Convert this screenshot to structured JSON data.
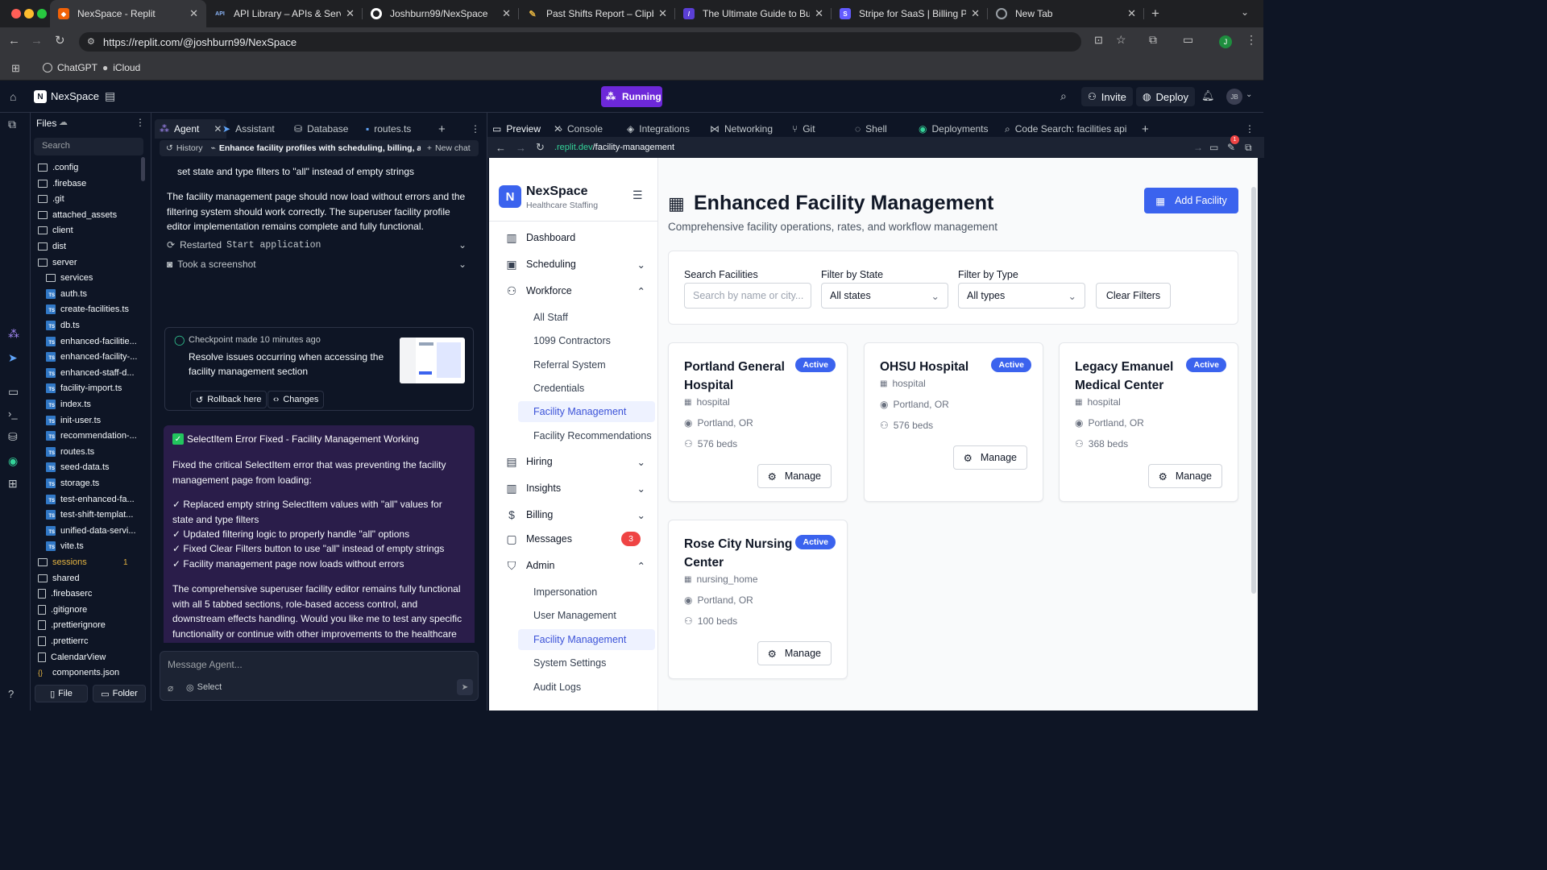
{
  "browser": {
    "tabs": [
      {
        "title": "NexSpace - Replit",
        "icon": "replit-icon",
        "color": "#f26207"
      },
      {
        "title": "API Library – APIs & Services",
        "icon": "api-icon",
        "color": "#4285f4"
      },
      {
        "title": "Joshburn99/NexSpace",
        "icon": "github-icon",
        "color": "#ffffff"
      },
      {
        "title": "Past Shifts Report – Clipboard",
        "icon": "clipboard-icon",
        "color": "#e3b341"
      },
      {
        "title": "The Ultimate Guide to Building",
        "icon": "guide-icon",
        "color": "#5b3fd6"
      },
      {
        "title": "Stripe for SaaS | Billing Platform",
        "icon": "stripe-icon",
        "color": "#635bff"
      },
      {
        "title": "New Tab",
        "icon": "chrome-icon",
        "color": "#9aa0a6"
      }
    ],
    "url": "https://replit.com/@joshburn99/NexSpace",
    "bookmarks": [
      "ChatGPT",
      "iCloud"
    ],
    "profile_initial": "J"
  },
  "replit": {
    "project": "NexSpace",
    "status": "Running",
    "invite": "Invite",
    "deploy": "Deploy",
    "avatar": "JB"
  },
  "files": {
    "title": "Files",
    "search_placeholder": "Search",
    "items": [
      {
        "name": ".config",
        "type": "folder",
        "depth": 0
      },
      {
        "name": ".firebase",
        "type": "folder",
        "depth": 0
      },
      {
        "name": ".git",
        "type": "folder",
        "depth": 0
      },
      {
        "name": "attached_assets",
        "type": "folder",
        "depth": 0
      },
      {
        "name": "client",
        "type": "folder",
        "depth": 0
      },
      {
        "name": "dist",
        "type": "folder",
        "depth": 0
      },
      {
        "name": "server",
        "type": "folder-open",
        "depth": 0
      },
      {
        "name": "services",
        "type": "folder",
        "depth": 1
      },
      {
        "name": "auth.ts",
        "type": "ts",
        "depth": 1
      },
      {
        "name": "create-facilities.ts",
        "type": "ts",
        "depth": 1
      },
      {
        "name": "db.ts",
        "type": "ts",
        "depth": 1
      },
      {
        "name": "enhanced-facilitie...",
        "type": "ts",
        "depth": 1
      },
      {
        "name": "enhanced-facility-...",
        "type": "ts",
        "depth": 1
      },
      {
        "name": "enhanced-staff-d...",
        "type": "ts",
        "depth": 1
      },
      {
        "name": "facility-import.ts",
        "type": "ts",
        "depth": 1
      },
      {
        "name": "index.ts",
        "type": "ts",
        "depth": 1
      },
      {
        "name": "init-user.ts",
        "type": "ts",
        "depth": 1
      },
      {
        "name": "recommendation-...",
        "type": "ts",
        "depth": 1
      },
      {
        "name": "routes.ts",
        "type": "ts",
        "depth": 1
      },
      {
        "name": "seed-data.ts",
        "type": "ts",
        "depth": 1
      },
      {
        "name": "storage.ts",
        "type": "ts",
        "depth": 1
      },
      {
        "name": "test-enhanced-fa...",
        "type": "ts",
        "depth": 1
      },
      {
        "name": "test-shift-templat...",
        "type": "ts",
        "depth": 1
      },
      {
        "name": "unified-data-servi...",
        "type": "ts",
        "depth": 1
      },
      {
        "name": "vite.ts",
        "type": "ts",
        "depth": 1
      },
      {
        "name": "sessions",
        "type": "folder",
        "depth": 0,
        "badge": "1"
      },
      {
        "name": "shared",
        "type": "folder",
        "depth": 0
      },
      {
        "name": ".firebaserc",
        "type": "doc",
        "depth": 0
      },
      {
        "name": ".gitignore",
        "type": "doc",
        "depth": 0
      },
      {
        "name": ".prettierignore",
        "type": "doc",
        "depth": 0
      },
      {
        "name": ".prettierrc",
        "type": "doc",
        "depth": 0
      },
      {
        "name": "CalendarView",
        "type": "doc",
        "depth": 0
      },
      {
        "name": "components.json",
        "type": "json",
        "depth": 0
      }
    ],
    "new_file": "File",
    "new_folder": "Folder"
  },
  "agent": {
    "tabs": [
      "Agent",
      "Assistant",
      "Database",
      "routes.ts"
    ],
    "history": "History",
    "thread_title": "Enhance facility profiles with scheduling, billing, and ...",
    "new_chat": "New chat",
    "partial_line": "set state and type filters to \"all\" instead of empty strings",
    "summary": "The facility management page should now load without errors and the filtering system should work correctly. The superuser facility profile editor implementation remains complete and fully functional.",
    "event1_prefix": "Restarted",
    "event1_code": "Start application",
    "event2": "Took a screenshot",
    "checkpoint": {
      "meta": "Checkpoint made 10 minutes ago",
      "text": "Resolve issues occurring when accessing the facility management section",
      "rollback": "Rollback here",
      "changes": "Changes"
    },
    "message": {
      "title": "SelectItem Error Fixed - Facility Management Working",
      "intro": "Fixed the critical SelectItem error that was preventing the facility management page from loading:",
      "bullets": [
        "✓ Replaced empty string SelectItem values with \"all\" values for state and type filters",
        "✓ Updated filtering logic to properly handle \"all\" options",
        "✓ Fixed Clear Filters button to use \"all\" instead of empty strings",
        "✓ Facility management page now loads without errors"
      ],
      "outro": "The comprehensive superuser facility editor remains fully functional with all 5 tabbed sections, role-based access control, and downstream effects handling. Would you like me to test any specific functionality or continue with other improvements to the healthcare scheduling platform?"
    },
    "input_placeholder": "Message Agent...",
    "select_label": "Select"
  },
  "preview": {
    "tabs": [
      "Preview",
      "Console",
      "Integrations",
      "Networking",
      "Git",
      "Shell",
      "Deployments",
      "Code Search: facilities api"
    ],
    "url_host": ".replit.dev",
    "url_path": "/facility-management",
    "notif_count": "1"
  },
  "app": {
    "brand": "NexSpace",
    "brand_initial": "N",
    "tagline": "Healthcare Staffing",
    "nav": [
      {
        "label": "Dashboard",
        "icon": "dashboard-icon"
      },
      {
        "label": "Scheduling",
        "icon": "calendar-icon",
        "chevron": "down"
      },
      {
        "label": "Workforce",
        "icon": "users-icon",
        "chevron": "up"
      },
      {
        "label": "Hiring",
        "icon": "briefcase-icon",
        "chevron": "down"
      },
      {
        "label": "Insights",
        "icon": "chart-icon",
        "chevron": "down"
      },
      {
        "label": "Billing",
        "icon": "dollar-icon",
        "chevron": "down"
      },
      {
        "label": "Messages",
        "icon": "message-icon",
        "badge": "3"
      },
      {
        "label": "Admin",
        "icon": "shield-icon",
        "chevron": "up"
      }
    ],
    "workforce_sub": [
      "All Staff",
      "1099 Contractors",
      "Referral System",
      "Credentials",
      "Facility Management",
      "Facility Recommendations"
    ],
    "admin_sub": [
      "Impersonation",
      "User Management",
      "Facility Management",
      "System Settings",
      "Audit Logs"
    ],
    "page_title": "Enhanced Facility Management",
    "page_subtitle": "Comprehensive facility operations, rates, and workflow management",
    "add_button": "Add Facility",
    "filters": {
      "search_label": "Search Facilities",
      "search_placeholder": "Search by name or city...",
      "state_label": "Filter by State",
      "state_value": "All states",
      "type_label": "Filter by Type",
      "type_value": "All types",
      "clear": "Clear Filters"
    },
    "facilities": [
      {
        "name": "Portland General Hospital",
        "status": "Active",
        "type": "hospital",
        "location": "Portland, OR",
        "beds": "576 beds",
        "action": "Manage"
      },
      {
        "name": "OHSU Hospital",
        "status": "Active",
        "type": "hospital",
        "location": "Portland, OR",
        "beds": "576 beds",
        "action": "Manage"
      },
      {
        "name": "Legacy Emanuel Medical Center",
        "status": "Active",
        "type": "hospital",
        "location": "Portland, OR",
        "beds": "368 beds",
        "action": "Manage"
      },
      {
        "name": "Rose City Nursing Center",
        "status": "Active",
        "type": "nursing_home",
        "location": "Portland, OR",
        "beds": "100 beds",
        "action": "Manage"
      }
    ],
    "accent": "#3b63ee"
  }
}
